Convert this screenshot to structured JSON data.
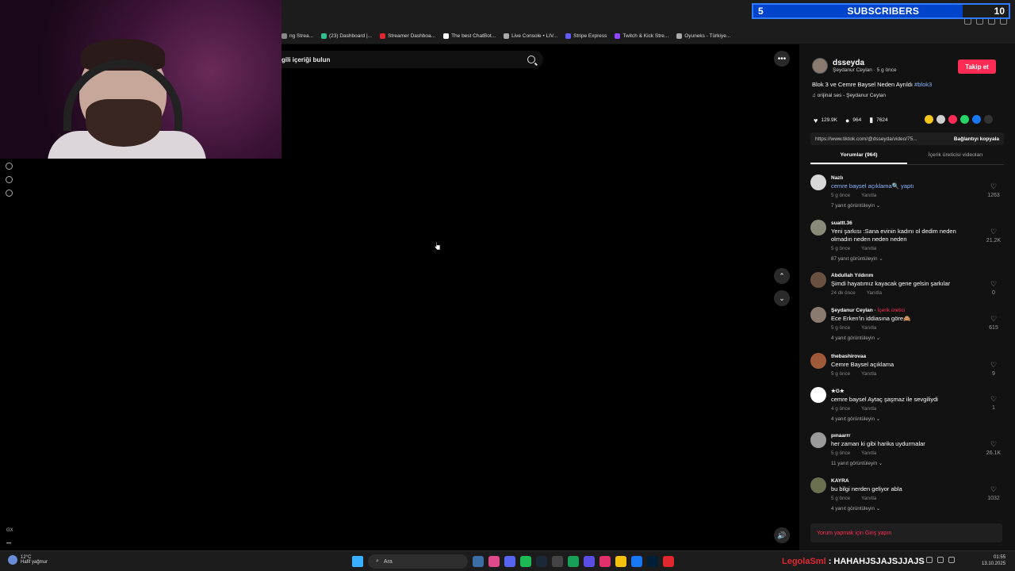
{
  "overlay": {
    "subs_left": "5",
    "subs_label": "SUBSCRIBERS",
    "subs_right": "10",
    "subs_progress": 0.82,
    "chat_user": "LegolaSml",
    "chat_msg": ": HAHAHJSJAJSJJAJS"
  },
  "bookmarks": [
    {
      "label": "ng Strea...",
      "color": "#888"
    },
    {
      "label": "(23) Dashboard |...",
      "color": "#2fbf8f"
    },
    {
      "label": "Streamer Dashboa...",
      "color": "#e0262f"
    },
    {
      "label": "The best ChatBot...",
      "color": "#fff"
    },
    {
      "label": "Live Console • LIV...",
      "color": "#aaa"
    },
    {
      "label": "Stripe Express",
      "color": "#635bff"
    },
    {
      "label": "Twitch & Kick Stre...",
      "color": "#9146ff"
    },
    {
      "label": "Oyuneks - Türkiye...",
      "color": "#aaa"
    }
  ],
  "search": {
    "text": "gili içeriği bulun"
  },
  "video_controls": {
    "more": "•••",
    "up": "⌃",
    "down": "⌄",
    "volume": "🔊"
  },
  "sidebar": {
    "bottom1": "GX",
    "bottom2": "•••"
  },
  "post": {
    "author": "dsseyda",
    "author_sub": "Şeydanur Ceylan · 5 g önce",
    "follow_label": "Takip et",
    "desc_text": "Blok 3 ve Cemre Baysel Neden Ayrıldı ",
    "desc_tag": "#blok3",
    "sound": "♫  orijinal ses - Şeydanur Ceylan",
    "likes": "129.9K",
    "comments_count": "964",
    "saves": "7624",
    "link": "https://www.tiktok.com/@dsseyda/video/75...",
    "copy_label": "Bağlantıyı kopyala",
    "share_colors": [
      "#f5c518",
      "#cfcfcf",
      "#fe2c55",
      "#25d366",
      "#1877f2",
      "#333333"
    ]
  },
  "tabs": [
    {
      "label": "Yorumlar (964)"
    },
    {
      "label": "İçerik üreticisi videoları"
    }
  ],
  "comments": [
    {
      "name": "Nazlı",
      "badge": "",
      "text": "cemre baysel açıklama🔍 yaptı",
      "link": true,
      "time": "5 g önce",
      "reply": "Yanıtla",
      "replies": "7 yanıt görüntüleyin ⌄",
      "likes": "1263",
      "avatar": "#d8d8d8"
    },
    {
      "name": "suattt.36",
      "badge": "",
      "text": "Yeni şarkısı :Sana evinin kadını ol dedim neden olmadın neden neden neden",
      "link": false,
      "time": "5 g önce",
      "reply": "Yanıtla",
      "replies": "87 yanıt görüntüleyin ⌄",
      "likes": "21.2K",
      "avatar": "#8a8a78"
    },
    {
      "name": "Abdullah Yıldırım",
      "badge": "",
      "text": "Şimdi hayatımız kayacak gene gelsin şarkılar",
      "link": false,
      "time": "24 dk önce",
      "reply": "Yanıtla",
      "replies": "",
      "likes": "0",
      "avatar": "#6a5040"
    },
    {
      "name": "Şeydanur Ceylan · ",
      "badge": "İçerik üretici",
      "text": "Ece Erken'in iddiasına göre🙈",
      "link": false,
      "time": "5 g önce",
      "reply": "Yanıtla",
      "replies": "4 yanıt görüntüleyin ⌄",
      "likes": "615",
      "avatar": "#8a7a70"
    },
    {
      "name": "thebashirovaa",
      "badge": "",
      "text": "Cemre Baysel açıklama",
      "link": false,
      "time": "5 g önce",
      "reply": "Yanıtla",
      "replies": "",
      "likes": "9",
      "avatar": "#a05a3a"
    },
    {
      "name": "★G★",
      "badge": "",
      "text": "cemre baysel Aytaç şaşmaz ile sevgiliydi",
      "link": false,
      "time": "4 g önce",
      "reply": "Yanıtla",
      "replies": "4 yanıt görüntüleyin ⌄",
      "likes": "1",
      "avatar": "#ffffff"
    },
    {
      "name": "pınaarrr",
      "badge": "",
      "text": "her zaman ki gibi harika uydurmalar",
      "link": false,
      "time": "5 g önce",
      "reply": "Yanıtla",
      "replies": "11 yanıt görüntüleyin ⌄",
      "likes": "26.1K",
      "avatar": "#9a9a9a"
    },
    {
      "name": "KAYRA",
      "badge": "",
      "text": "bu bilgi nerden geliyor abla",
      "link": false,
      "time": "5 g önce",
      "reply": "Yanıtla",
      "replies": "4 yanıt görüntüleyin ⌄",
      "likes": "1032",
      "avatar": "#6a7050"
    }
  ],
  "comment_input": {
    "placeholder": "Yorum yapmak için Giriş yapın"
  },
  "taskbar": {
    "temp": "12°C",
    "weather": "Hafif yağmur",
    "search_label": "Ara",
    "time": "01:55",
    "date": "13.10.2025",
    "apps": [
      "#3a6ea5",
      "#e04a8a",
      "#5865f2",
      "#1db954",
      "#1b2838",
      "#444444",
      "#18a058",
      "#5b4ee6",
      "#e1306c",
      "#f4c20d",
      "#1877f2",
      "#001e36",
      "#e0262f"
    ]
  }
}
